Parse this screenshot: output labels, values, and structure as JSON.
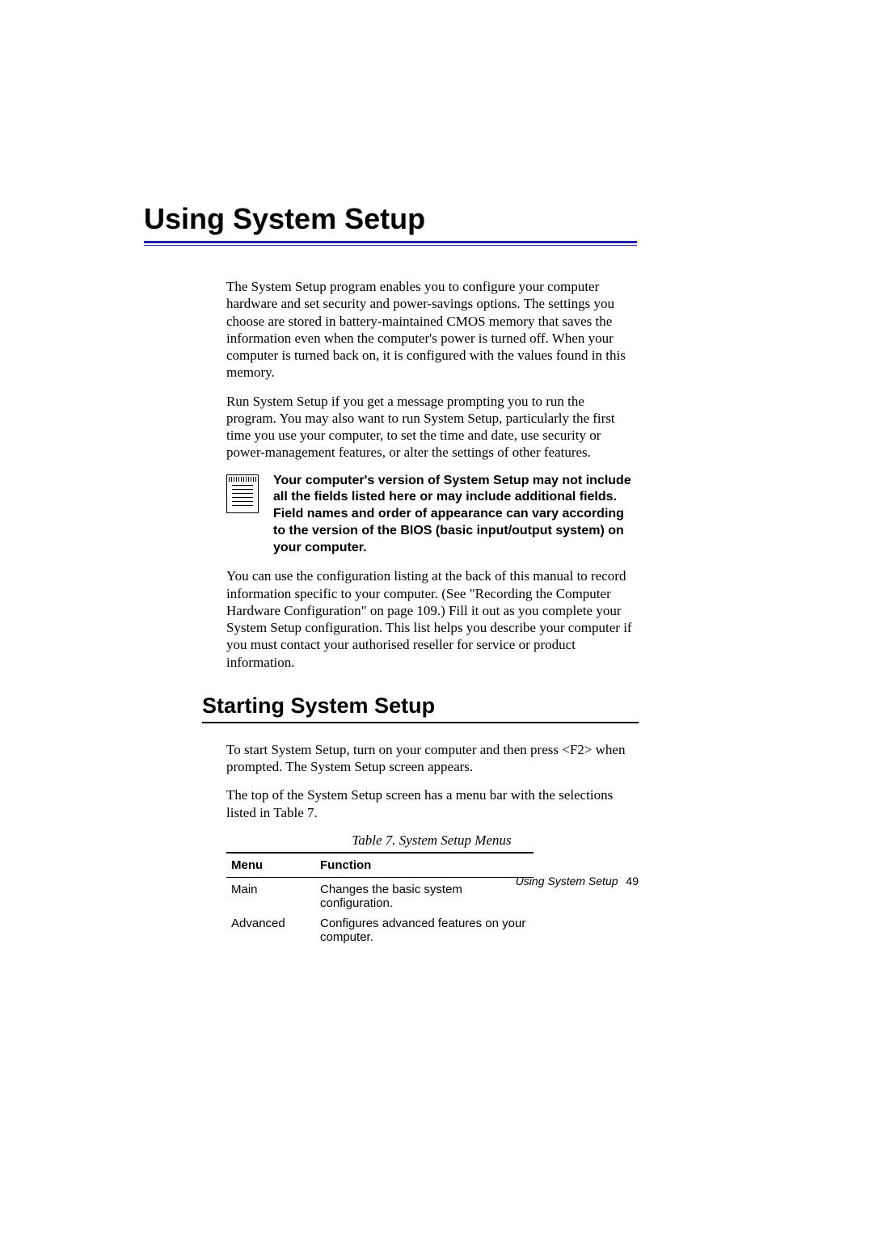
{
  "chapter": {
    "title": "Using System Setup"
  },
  "paragraphs": {
    "p1": "The System Setup program enables you to configure your computer hardware and set security and power-savings options. The settings you choose are stored in battery-maintained CMOS memory that saves the information even when the computer's power is turned off. When your computer is turned back on, it is configured with the values found in this memory.",
    "p2": "Run System Setup if you get a message prompting you to run the program. You may also want to run System Setup, particularly the first time you use your computer, to set the time and date, use security or power-management features, or alter the settings of other features.",
    "note": "Your computer's version of System Setup may not include all the fields listed here or may include additional fields. Field names and order of appearance can vary according to the version of the BIOS (basic input/output system) on your computer.",
    "p3": "You can use the configuration listing at the back of this manual to record information specific to your computer. (See \"Recording the Computer Hardware Configuration\" on page 109.) Fill it out as you complete your System Setup configuration. This list helps you describe your computer if you must contact your authorised reseller for service or product information."
  },
  "section": {
    "heading": "Starting System Setup",
    "p1": "To start System Setup, turn on your computer and then press <F2> when prompted. The System Setup screen appears.",
    "p2": "The top of the System Setup screen has a menu bar with the selections listed in Table 7."
  },
  "table": {
    "caption": "Table 7.  System Setup Menus",
    "headers": {
      "menu": "Menu",
      "function": "Function"
    },
    "rows": [
      {
        "menu": "Main",
        "function": "Changes the basic system configuration."
      },
      {
        "menu": "Advanced",
        "function": "Configures advanced features on your computer."
      }
    ]
  },
  "footer": {
    "text": "Using System Setup",
    "page": "49"
  }
}
